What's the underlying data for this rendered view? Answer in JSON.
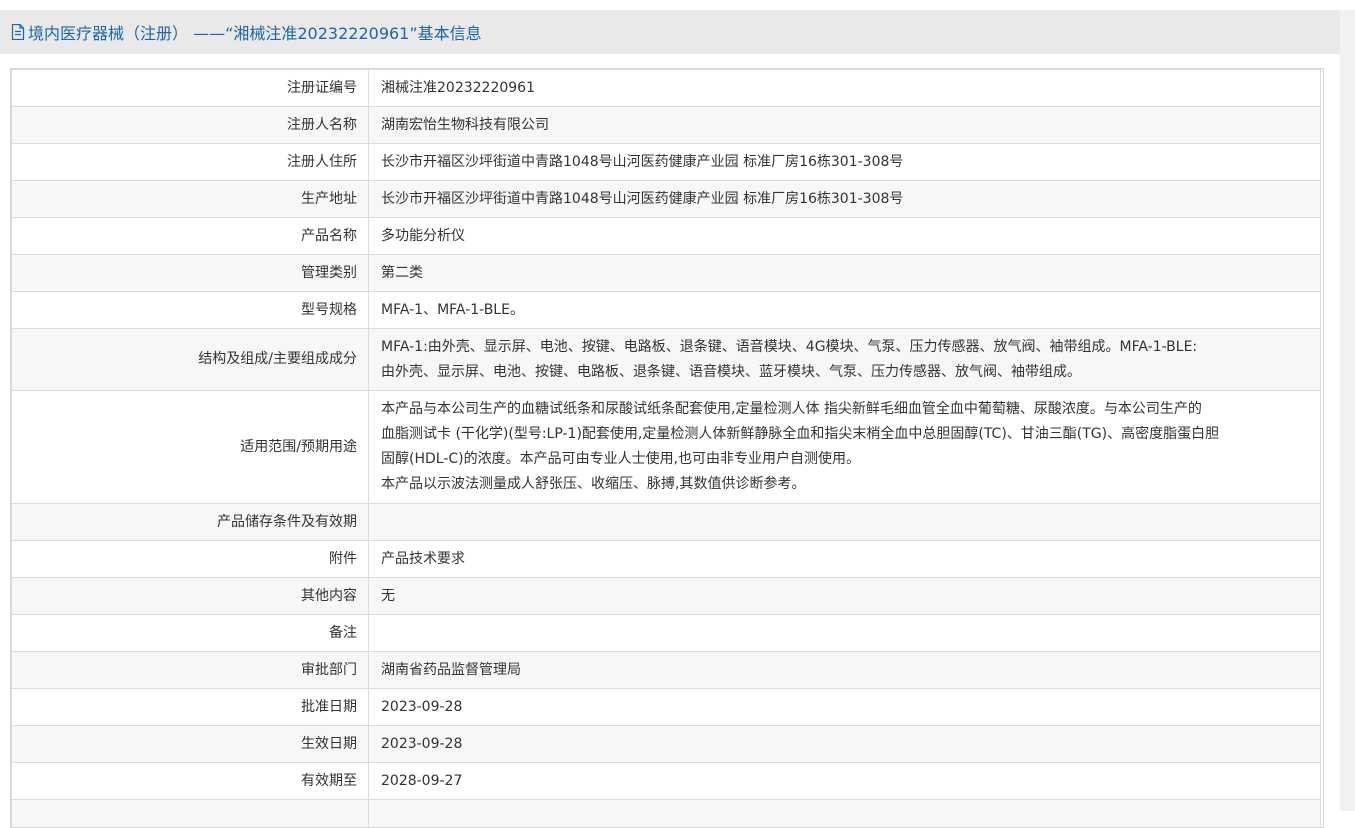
{
  "header": {
    "title": "境内医疗器械（注册） ——“湘械注准20232220961”基本信息",
    "icon": "document-icon"
  },
  "rows": [
    {
      "label": "注册证编号",
      "lines": [
        "湘械注准20232220961"
      ]
    },
    {
      "label": "注册人名称",
      "lines": [
        "湖南宏怡生物科技有限公司"
      ]
    },
    {
      "label": "注册人住所",
      "lines": [
        "长沙市开福区沙坪街道中青路1048号山河医药健康产业园 标准厂房16栋301-308号"
      ]
    },
    {
      "label": "生产地址",
      "lines": [
        "长沙市开福区沙坪街道中青路1048号山河医药健康产业园 标准厂房16栋301-308号"
      ]
    },
    {
      "label": "产品名称",
      "lines": [
        "多功能分析仪"
      ]
    },
    {
      "label": "管理类别",
      "lines": [
        "第二类"
      ]
    },
    {
      "label": "型号规格",
      "lines": [
        "MFA-1、MFA-1-BLE。"
      ]
    },
    {
      "label": "结构及组成/主要组成成分",
      "lines": [
        "MFA-1:由外壳、显示屏、电池、按键、电路板、退条键、语音模块、4G模块、气泵、压力传感器、放气阀、袖带组成。MFA-1-BLE:",
        "由外壳、显示屏、电池、按键、电路板、退条键、语音模块、蓝牙模块、气泵、压力传感器、放气阀、袖带组成。"
      ]
    },
    {
      "label": "适用范围/预期用途",
      "lines": [
        "本产品与本公司生产的血糖试纸条和尿酸试纸条配套使用,定量检测人体 指尖新鲜毛细血管全血中葡萄糖、尿酸浓度。与本公司生产的",
        "血脂测试卡 (干化学)(型号:LP-1)配套使用,定量检测人体新鲜静脉全血和指尖末梢全血中总胆固醇(TC)、甘油三酯(TG)、高密度脂蛋白胆",
        "固醇(HDL-C)的浓度。本产品可由专业人士使用,也可由非专业用户自测使用。",
        "本产品以示波法测量成人舒张压、收缩压、脉搏,其数值供诊断参考。"
      ]
    },
    {
      "label": "产品储存条件及有效期",
      "lines": [
        ""
      ]
    },
    {
      "label": "附件",
      "lines": [
        "产品技术要求"
      ]
    },
    {
      "label": "其他内容",
      "lines": [
        "无"
      ]
    },
    {
      "label": "备注",
      "lines": [
        ""
      ]
    },
    {
      "label": "审批部门",
      "lines": [
        "湖南省药品监督管理局"
      ]
    },
    {
      "label": "批准日期",
      "lines": [
        "2023-09-28"
      ]
    },
    {
      "label": "生效日期",
      "lines": [
        "2023-09-28"
      ]
    },
    {
      "label": "有效期至",
      "lines": [
        "2028-09-27"
      ]
    },
    {
      "label": "",
      "lines": [
        ""
      ]
    }
  ]
}
